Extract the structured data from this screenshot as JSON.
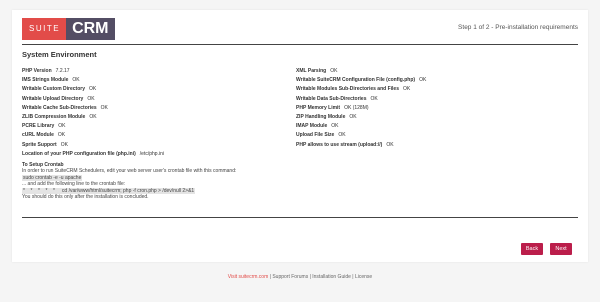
{
  "logo": {
    "suite": "SUITE",
    "crm": "CRM"
  },
  "header": {
    "step": "Step 1 of 2 - Pre-installation requirements"
  },
  "section": {
    "title": "System Environment"
  },
  "left_checks": [
    {
      "label": "PHP Version",
      "value": "7.2.17"
    },
    {
      "label": "IMS Strings Module",
      "value": "OK"
    },
    {
      "label": "Writable Custom Directory",
      "value": "OK"
    },
    {
      "label": "Writable Upload Directory",
      "value": "OK"
    },
    {
      "label": "Writable Cache Sub-Directories",
      "value": "OK"
    },
    {
      "label": "ZLIB Compression Module",
      "value": "OK"
    },
    {
      "label": "PCRE Library",
      "value": "OK"
    },
    {
      "label": "cURL Module",
      "value": "OK"
    },
    {
      "label": "Sprite Support",
      "value": "OK"
    },
    {
      "label": "Location of your PHP configuration file (php.ini)",
      "value": "/etc/php.ini"
    }
  ],
  "right_checks": [
    {
      "label": "XML Parsing",
      "value": "OK"
    },
    {
      "label": "Writable SuiteCRM Configuration File (config.php)",
      "value": "OK"
    },
    {
      "label": "Writable Modules Sub-Directories and Files",
      "value": "OK"
    },
    {
      "label": "Writable Data Sub-Directories",
      "value": "OK"
    },
    {
      "label": "PHP Memory Limit",
      "value": "OK (128M)"
    },
    {
      "label": "ZIP Handling Module",
      "value": "OK"
    },
    {
      "label": "IMAP Module",
      "value": "OK"
    },
    {
      "label": "Upload File Size",
      "value": "OK"
    },
    {
      "label": "PHP allows to use stream (upload://)",
      "value": "OK"
    }
  ],
  "crontab": {
    "title": "To Setup Crontab",
    "line1": "In order to run SuiteCRM Schedulers, edit your web server user's crontab file with this command:",
    "command1": "sudo crontab -e -u apache",
    "line2": "... and add the following line to the crontab file:",
    "command2": "*    *    *    *    *     cd /var/www/html/suitecrm; php -f cron.php > /dev/null 2>&1",
    "line3": "You should do this only after the installation is concluded."
  },
  "buttons": {
    "back": "Back",
    "next": "Next"
  },
  "footer": {
    "visit": "Visit suitecrm.com",
    "rest": " | Support Forums | Installation Guide | License"
  },
  "colors": {
    "brand_red": "#e24c49",
    "brand_purple": "#534d64",
    "button": "#bb1e4b"
  }
}
